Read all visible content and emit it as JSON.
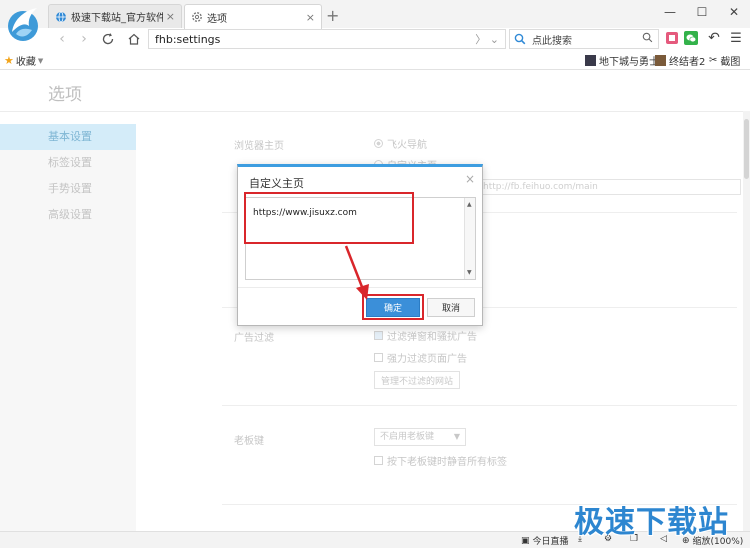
{
  "browser": {
    "tabs": [
      {
        "title": "极速下载站_官方软件下载_ji",
        "close": "×",
        "icon": "globe-icon"
      },
      {
        "title": "选项",
        "close": "×",
        "icon": "gear-icon"
      }
    ],
    "new_tab": "+",
    "window_controls": {
      "minimize": "—",
      "maximize": "☐",
      "close": "✕"
    },
    "address": "fhb:settings",
    "address_buttons": "〉 ⌄",
    "search_placeholder": "点此搜索",
    "bookmarks": {
      "favorites_label": "收藏",
      "items": [
        "地下城与勇士",
        "终结者2",
        "截图"
      ]
    }
  },
  "settings": {
    "title": "选项",
    "nav": [
      "基本设置",
      "标签设置",
      "手势设置",
      "高级设置"
    ],
    "homepage_label": "浏览器主页",
    "homepage_option_1": "飞火导航",
    "homepage_option_2": "自定义主页",
    "homepage_url": "http://fb.feihuo.com/main",
    "ad_filter_label": "广告过滤",
    "ad_filter_opt1": "过滤弹窗和骚扰广告",
    "ad_filter_opt2": "强力过滤页面广告",
    "ad_filter_btn": "管理不过滤的网站",
    "boss_key_label": "老板键",
    "boss_key_select": "不启用老板键",
    "boss_key_option": "按下老板键时静音所有标签"
  },
  "dialog": {
    "title": "自定义主页",
    "close": "×",
    "textarea_value": "https://www.jisuxz.com",
    "ok_label": "确定",
    "cancel_label": "取消"
  },
  "statusbar": {
    "today_live": "今日直播",
    "zoom": "缩放(100%)"
  },
  "watermark": "极速下载站",
  "colors": {
    "accent": "#3b8fd9",
    "highlight_red": "#d9262b",
    "dialog_top_border": "#3d9de0"
  }
}
